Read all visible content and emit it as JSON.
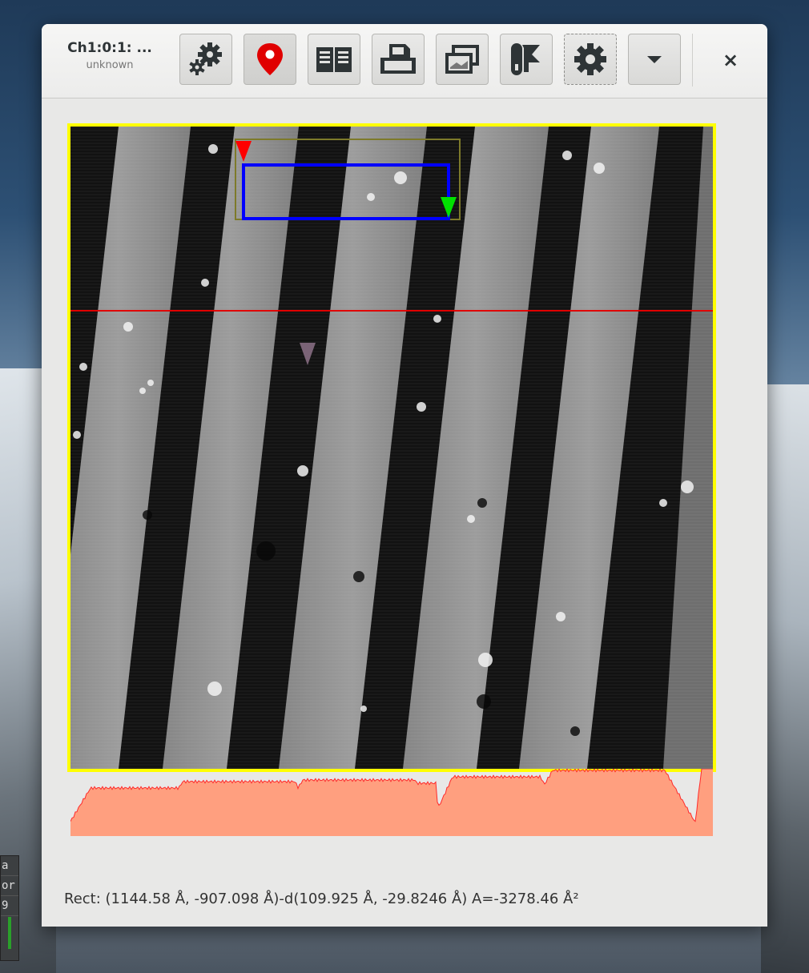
{
  "window": {
    "title": "Ch1:0:1: ...",
    "subtitle": "unknown"
  },
  "toolbar": {
    "buttons": [
      {
        "name": "channel-settings-button",
        "icon": "gears-icon"
      },
      {
        "name": "marker-button",
        "icon": "map-pin-icon",
        "active": true
      },
      {
        "name": "info-book-button",
        "icon": "book-icon"
      },
      {
        "name": "print-button",
        "icon": "printer-icon"
      },
      {
        "name": "view-layers-button",
        "icon": "layers-icon"
      },
      {
        "name": "clip-tool-button",
        "icon": "clip-icon"
      },
      {
        "name": "view-options-button",
        "icon": "gear-icon",
        "focused": true
      },
      {
        "name": "menu-dropdown-button",
        "icon": "chevron-down-icon"
      }
    ],
    "close_label": "×"
  },
  "image": {
    "frame_color": "#ffff00",
    "rect_color": "#0000ff",
    "line_color": "#ff0000",
    "marker_start_color": "#ff0000",
    "marker_end_color": "#00ff00"
  },
  "profile": {
    "fill_color": "#ff9f7f",
    "edge_color": "#ff0000"
  },
  "status": {
    "text": "Rect: (1144.58 Å, -907.098 Å)-d(109.925 Å, -29.8246 Å) A=-3278.46 Å²"
  },
  "background": {
    "strip_lines": [
      "a",
      "or",
      "9"
    ]
  }
}
